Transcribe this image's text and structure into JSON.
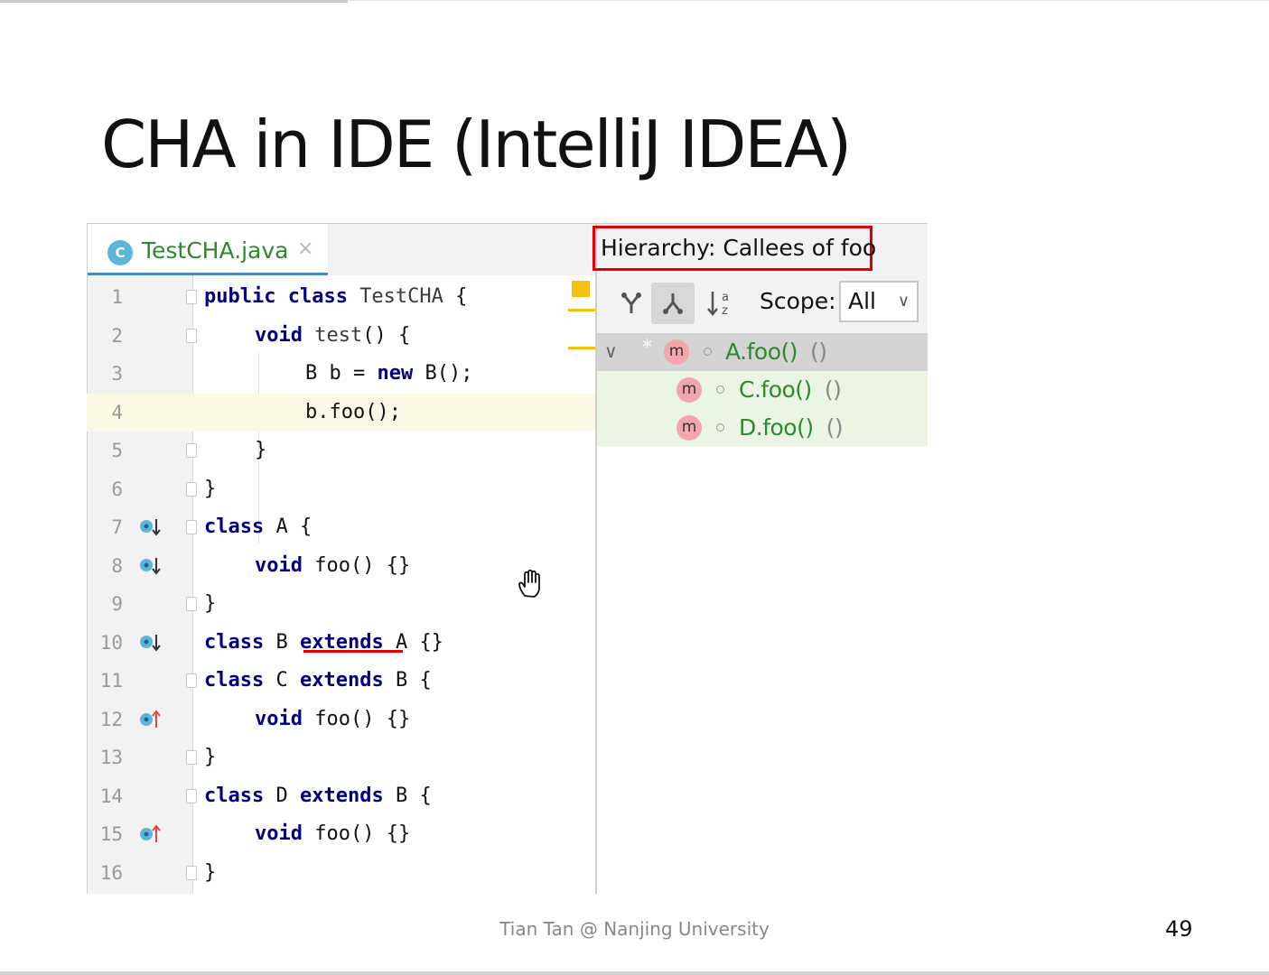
{
  "slide": {
    "title": "CHA in IDE (IntelliJ IDEA)",
    "footer": "Tian Tan @ Nanjing University",
    "page_number": "49"
  },
  "editor": {
    "tab_icon": "C",
    "tab_label": "TestCHA.java",
    "tab_close": "×",
    "lines": [
      {
        "num": "1"
      },
      {
        "num": "2"
      },
      {
        "num": "3"
      },
      {
        "num": "4"
      },
      {
        "num": "5"
      },
      {
        "num": "6"
      },
      {
        "num": "7"
      },
      {
        "num": "8"
      },
      {
        "num": "9"
      },
      {
        "num": "10"
      },
      {
        "num": "11"
      },
      {
        "num": "12"
      },
      {
        "num": "13"
      },
      {
        "num": "14"
      },
      {
        "num": "15"
      },
      {
        "num": "16"
      }
    ],
    "code": {
      "l1_kw": "public class ",
      "l1_name": "TestCHA",
      "l1_rest": " {",
      "l2_kw": "void ",
      "l2_name": "test",
      "l2_rest": "() {",
      "l3_a": "B b = ",
      "l3_kw": "new",
      "l3_b": " B();",
      "l4": "b.foo();",
      "l5": "}",
      "l6": "}",
      "l7_kw": "class",
      "l7_rest": " A {",
      "l8_kw": "void",
      "l8_rest": " foo() {}",
      "l9": "}",
      "l10_kw": "class",
      "l10_a": " B ",
      "l10_kw2": "extends",
      "l10_b": " A {}",
      "l11_kw": "class",
      "l11_a": " C ",
      "l11_kw2": "extends",
      "l11_b": " B {",
      "l12_kw": "void",
      "l12_rest": " foo() {}",
      "l13": "}",
      "l14_kw": "class",
      "l14_a": " D ",
      "l14_kw2": "extends",
      "l14_b": " B {",
      "l15_kw": "void",
      "l15_rest": " foo() {}",
      "l16": "}"
    }
  },
  "hierarchy": {
    "title": "Hierarchy:  Callees of foo",
    "scope_label": "Scope:",
    "scope_value": "All",
    "tree": [
      {
        "icon": "m",
        "method": "A.foo()",
        "args": "()"
      },
      {
        "icon": "m",
        "method": "C.foo()",
        "args": "()"
      },
      {
        "icon": "m",
        "method": "D.foo()",
        "args": "()"
      }
    ]
  },
  "colors": {
    "highlight_box": "#e00000",
    "method_green": "#2c8a2c",
    "keyword_blue": "#000080",
    "current_line": "#fdf8e6"
  },
  "icons": [
    "file-class-icon",
    "close-icon",
    "implemented-down-icon",
    "overrides-up-icon",
    "caller-hierarchy-icon",
    "callee-hierarchy-icon",
    "sort-alpha-icon",
    "chevron-down-icon",
    "method-icon",
    "hand-cursor-icon"
  ]
}
